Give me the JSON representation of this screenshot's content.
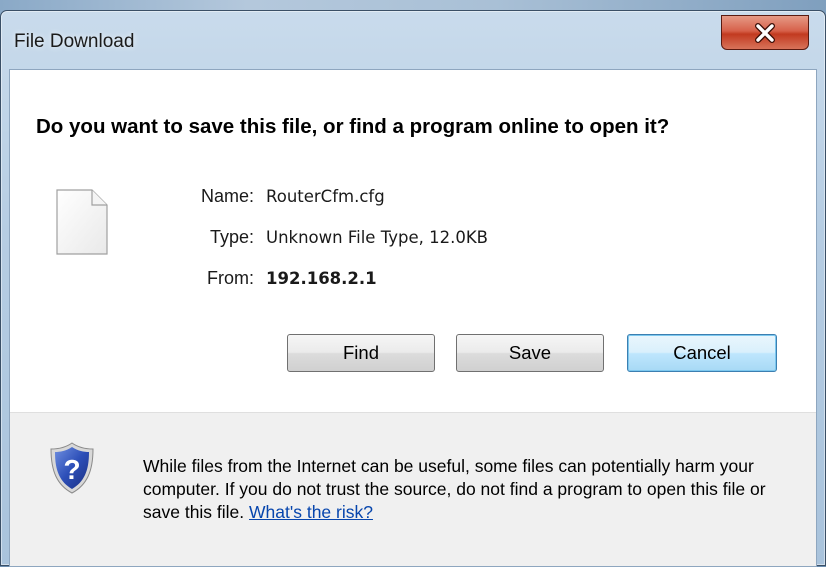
{
  "dialog": {
    "title": "File Download",
    "question": "Do you want to save this file, or find a program online to open it?",
    "file": {
      "name_label": "Name:",
      "name_value": "RouterCfm.cfg",
      "type_label": "Type:",
      "type_value": "Unknown File Type, 12.0KB",
      "from_label": "From:",
      "from_value": "192.168.2.1"
    },
    "buttons": {
      "find": "Find",
      "save": "Save",
      "cancel": "Cancel"
    },
    "warning": {
      "text": "While files from the Internet can be useful, some files can potentially harm your computer. If you do not trust the source, do not find a program to open this file or save this file. ",
      "link": "What's the risk?"
    }
  },
  "colors": {
    "close_button": "#c23a20",
    "link": "#0645ad",
    "default_button_border": "#3c7fb1"
  },
  "icons": {
    "file": "blank-file-icon",
    "close": "close-icon",
    "security": "shield-question-icon"
  }
}
